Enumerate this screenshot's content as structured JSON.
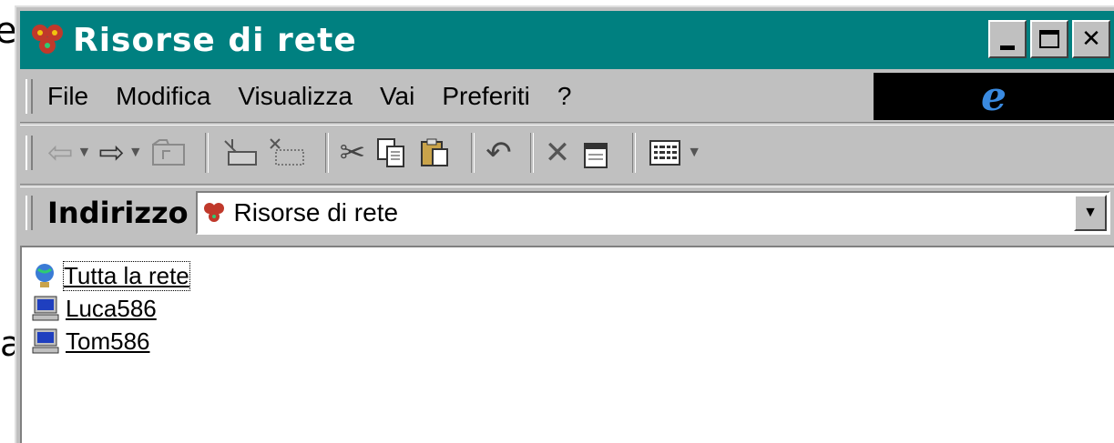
{
  "window": {
    "title": "Risorse di rete"
  },
  "menu": [
    "File",
    "Modifica",
    "Visualizza",
    "Vai",
    "Preferiti",
    "?"
  ],
  "address": {
    "label": "Indirizzo",
    "value": "Risorse di rete"
  },
  "items": [
    {
      "label": "Tutta la rete",
      "icon": "globe-icon"
    },
    {
      "label": "Luca586",
      "icon": "computer-icon"
    },
    {
      "label": "Tom586",
      "icon": "computer-icon"
    }
  ],
  "background_fragments": {
    "top": "e",
    "bottom": "a"
  }
}
